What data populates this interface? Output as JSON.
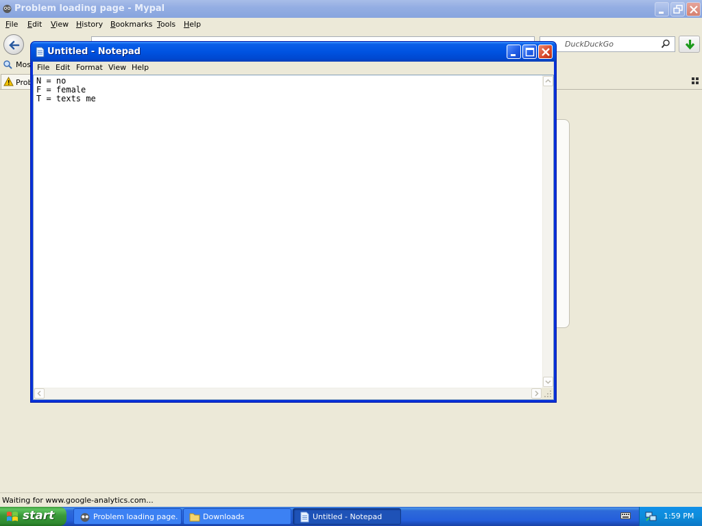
{
  "browser": {
    "title": "Problem loading page - Mypal",
    "menu": [
      {
        "key": "F",
        "rest": "ile"
      },
      {
        "key": "E",
        "rest": "dit"
      },
      {
        "key": "V",
        "rest": "iew"
      },
      {
        "key": "H",
        "rest": "istory"
      },
      {
        "key": "B",
        "rest": "ookmarks"
      },
      {
        "key": "T",
        "rest": "ools"
      },
      {
        "key": "H",
        "rest": "elp"
      }
    ],
    "search_placeholder": "DuckDuckGo",
    "bookmark_label": "Most",
    "tab_label": "Prob",
    "status_text": "Waiting for www.google-analytics.com..."
  },
  "notepad": {
    "title": "Untitled - Notepad",
    "menu": [
      "File",
      "Edit",
      "Format",
      "View",
      "Help"
    ],
    "lines": [
      "N = no",
      "F = female",
      "T = texts me"
    ]
  },
  "taskbar": {
    "start_label": "start",
    "tasks": [
      {
        "label": "Problem loading page...",
        "icon": "mypal-icon",
        "active": false
      },
      {
        "label": "Downloads",
        "icon": "folder-icon",
        "active": false
      },
      {
        "label": "Untitled - Notepad",
        "icon": "notepad-icon",
        "active": true
      }
    ],
    "clock": "1:59 PM"
  },
  "colors": {
    "titlebar_active": "#0053e1",
    "titlebar_inactive": "#94aee3",
    "taskbar": "#245edb",
    "start_button": "#3a9a3a",
    "desktop_face": "#ece9d8"
  }
}
